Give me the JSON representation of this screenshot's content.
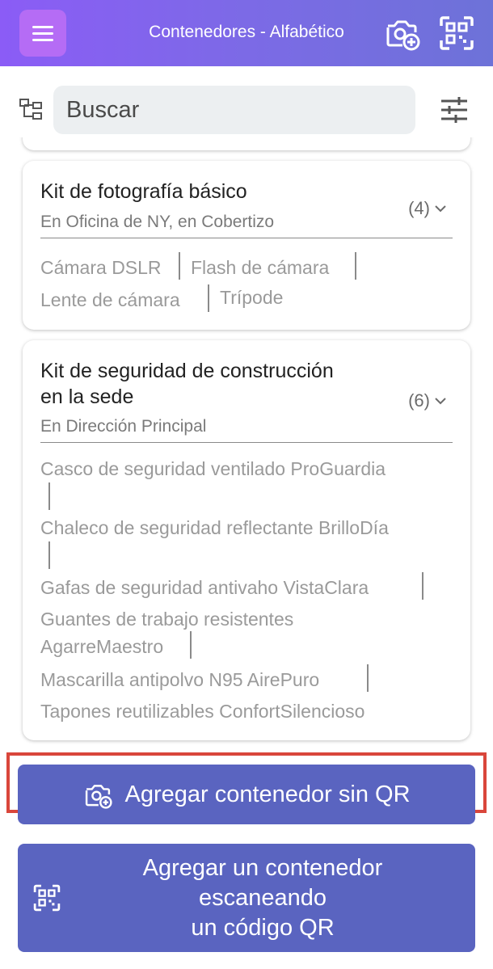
{
  "header": {
    "title": "Contenedores - Alfabético",
    "menu_icon": "hamburger-menu-icon",
    "add_photo_icon": "camera-add-icon",
    "scan_icon": "qr-scan-icon",
    "gradient_start": "#8b5cf6",
    "gradient_end": "#6d72d8"
  },
  "search": {
    "placeholder": "Buscar",
    "tree_icon": "hierarchy-icon",
    "filter_icon": "sliders-icon"
  },
  "cards": [
    {
      "title": "Kit de fotografía básico",
      "count": "(4)",
      "location": "En Oficina de NY, en Cobertizo",
      "items": [
        "Cámara DSLR",
        "Flash de cámara",
        "Lente de cámara",
        "Trípode"
      ]
    },
    {
      "title_line1": "Kit de seguridad de construcción",
      "title_line2": "en la sede",
      "count": "(6)",
      "location": "En Dirección Principal",
      "items": [
        "Casco de seguridad ventilado ProGuardia",
        "Chaleco de seguridad reflectante BrilloDía",
        "Gafas de seguridad antivaho VistaClara",
        "Guantes de trabajo resistentes",
        "AgarreMaestro",
        "Mascarilla antipolvo N95 AirePuro",
        "Tapones reutilizables ConfortSilencioso"
      ]
    }
  ],
  "buttons": {
    "add_no_qr": "Agregar contenedor sin QR",
    "add_scan_line1": "Agregar un contenedor",
    "add_scan_line2": "escaneando",
    "add_scan_line3": "un código QR",
    "button_color": "#5a64c0",
    "highlight_color": "#d9463b"
  }
}
